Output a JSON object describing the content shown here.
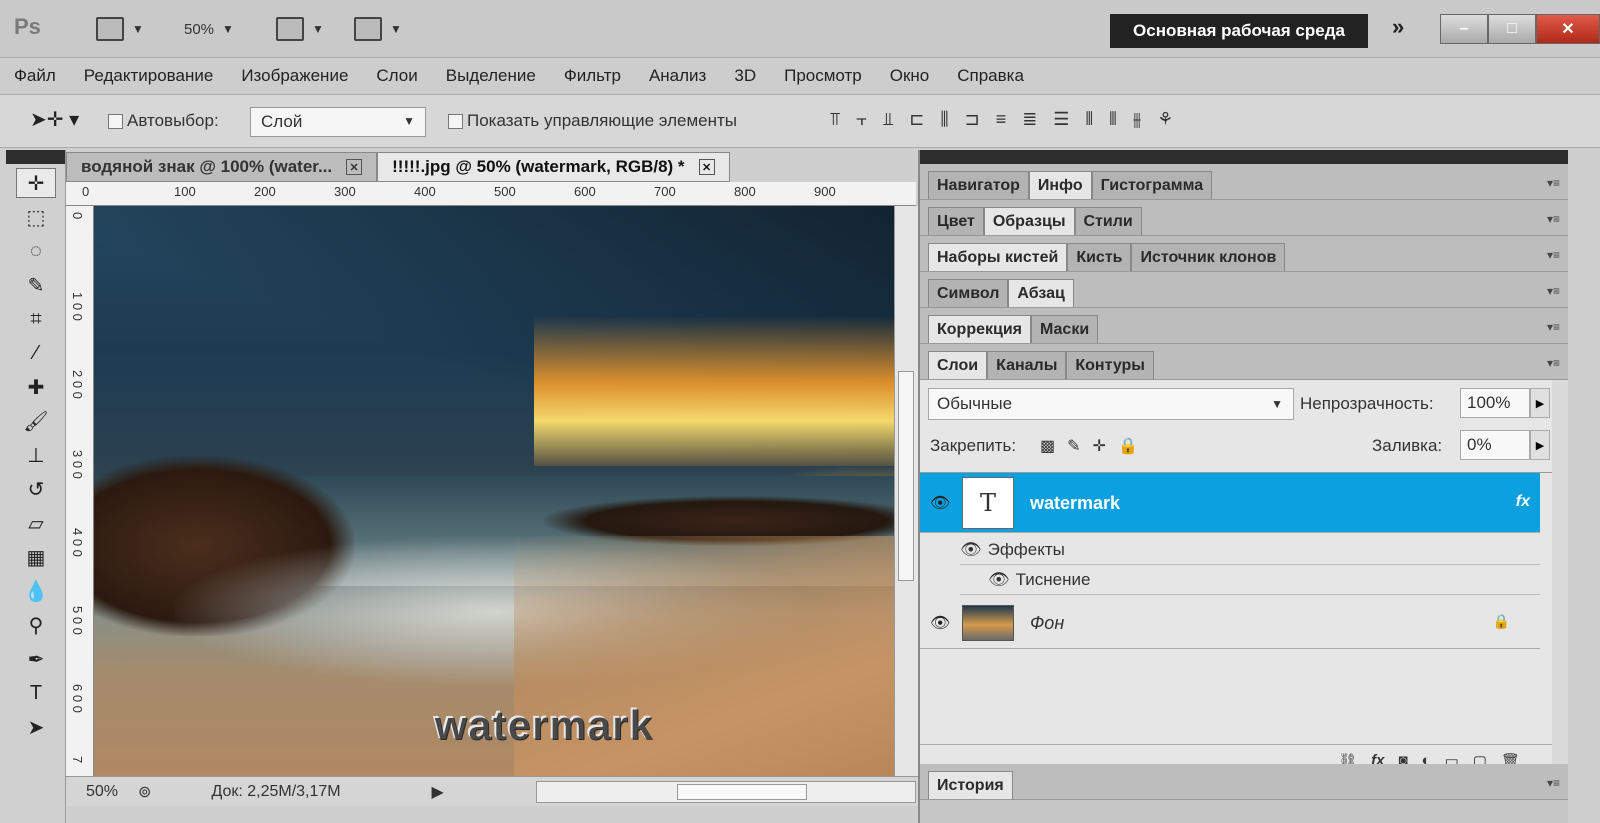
{
  "app": {
    "logo": "Ps",
    "zoom_value": "50%",
    "workspace": "Основная рабочая среда"
  },
  "menu": [
    "Файл",
    "Редактирование",
    "Изображение",
    "Слои",
    "Выделение",
    "Фильтр",
    "Анализ",
    "3D",
    "Просмотр",
    "Окно",
    "Справка"
  ],
  "options": {
    "autoselect_label": "Автовыбор:",
    "autoselect_value": "Слой",
    "show_controls_label": "Показать управляющие элементы"
  },
  "doc_tabs": [
    {
      "label": "водяной знак @ 100% (water..."
    },
    {
      "label": "!!!!!.jpg @ 50% (watermark, RGB/8) *"
    }
  ],
  "ruler_h": [
    "0",
    "100",
    "200",
    "300",
    "400",
    "500",
    "600",
    "700",
    "800",
    "900"
  ],
  "ruler_v": [
    "0",
    "1 0 0",
    "2 0 0",
    "3 0 0",
    "4 0 0",
    "5 0 0",
    "6 0 0",
    "7"
  ],
  "canvas": {
    "watermark_text": "watermark"
  },
  "status": {
    "zoom": "50%",
    "doc": "Док: 2,25M/3,17M"
  },
  "panels": {
    "group1": [
      "Навигатор",
      "Инфо",
      "Гистограмма"
    ],
    "group2": [
      "Цвет",
      "Образцы",
      "Стили"
    ],
    "group3": [
      "Наборы кистей",
      "Кисть",
      "Источник клонов"
    ],
    "group4": [
      "Символ",
      "Абзац"
    ],
    "group5": [
      "Коррекция",
      "Маски"
    ],
    "group6": [
      "Слои",
      "Каналы",
      "Контуры"
    ],
    "history": "История"
  },
  "layers": {
    "blend_mode": "Обычные",
    "opacity_label": "Непрозрачность:",
    "opacity_value": "100%",
    "lock_label": "Закрепить:",
    "fill_label": "Заливка:",
    "fill_value": "0%",
    "items": [
      {
        "name": "watermark",
        "thumb": "T",
        "fx": "fx"
      },
      {
        "name": "Фон"
      }
    ],
    "effects_label": "Эффекты",
    "emboss_label": "Тиснение"
  },
  "colors": {
    "accent": "#0ba0e0",
    "workspace_bg": "#222222"
  }
}
